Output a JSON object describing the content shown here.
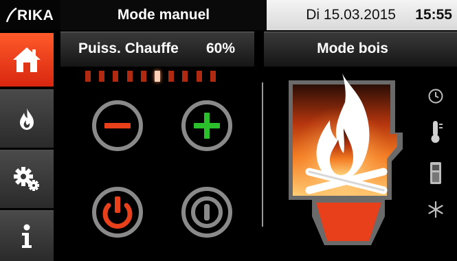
{
  "header": {
    "brand": "RIKA",
    "mode_title": "Mode manuel",
    "date": "Di 15.03.2015",
    "time": "15:55"
  },
  "sidebar": {
    "items": [
      {
        "icon": "home-icon",
        "active": true
      },
      {
        "icon": "flame-icon",
        "active": false
      },
      {
        "icon": "gears-icon",
        "active": false
      },
      {
        "icon": "info-icon",
        "active": false
      }
    ]
  },
  "power": {
    "label": "Puiss. Chauffe",
    "value": "60%",
    "level_steps": 10,
    "active_step": 6
  },
  "controls": {
    "minus": "minus-icon",
    "plus": "plus-icon",
    "on": "power-on-icon",
    "off": "power-off-icon"
  },
  "right": {
    "mode": "Mode bois",
    "status_icons": [
      "clock-icon",
      "thermometer-icon",
      "phone-icon",
      "snowflake-icon"
    ]
  },
  "colors": {
    "accent": "#e8401a",
    "green": "#2bc02b",
    "gray": "#8a8a8a"
  }
}
